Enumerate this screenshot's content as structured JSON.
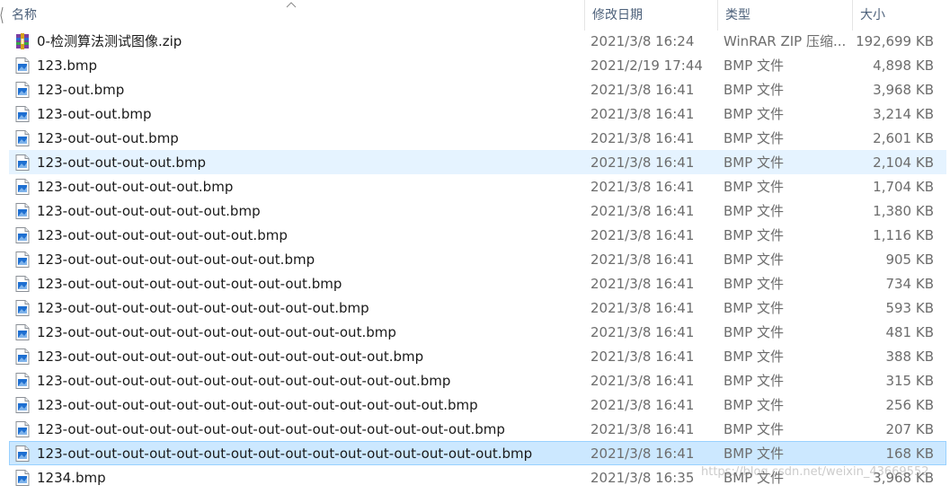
{
  "columns": {
    "name": "名称",
    "date": "修改日期",
    "type": "类型",
    "size": "大小"
  },
  "files": [
    {
      "name": "0-检测算法测试图像.zip",
      "date": "2021/3/8 16:24",
      "type": "WinRAR ZIP 压缩...",
      "size": "192,699 KB",
      "icon": "winrar-archive-icon"
    },
    {
      "name": "123.bmp",
      "date": "2021/2/19 17:44",
      "type": "BMP 文件",
      "size": "4,898 KB",
      "icon": "bmp-file-icon"
    },
    {
      "name": "123-out.bmp",
      "date": "2021/3/8 16:41",
      "type": "BMP 文件",
      "size": "3,968 KB",
      "icon": "bmp-file-icon"
    },
    {
      "name": "123-out-out.bmp",
      "date": "2021/3/8 16:41",
      "type": "BMP 文件",
      "size": "3,214 KB",
      "icon": "bmp-file-icon"
    },
    {
      "name": "123-out-out-out.bmp",
      "date": "2021/3/8 16:41",
      "type": "BMP 文件",
      "size": "2,601 KB",
      "icon": "bmp-file-icon"
    },
    {
      "name": "123-out-out-out-out.bmp",
      "date": "2021/3/8 16:41",
      "type": "BMP 文件",
      "size": "2,104 KB",
      "icon": "bmp-file-icon",
      "state": "hover"
    },
    {
      "name": "123-out-out-out-out-out.bmp",
      "date": "2021/3/8 16:41",
      "type": "BMP 文件",
      "size": "1,704 KB",
      "icon": "bmp-file-icon"
    },
    {
      "name": "123-out-out-out-out-out-out.bmp",
      "date": "2021/3/8 16:41",
      "type": "BMP 文件",
      "size": "1,380 KB",
      "icon": "bmp-file-icon"
    },
    {
      "name": "123-out-out-out-out-out-out-out.bmp",
      "date": "2021/3/8 16:41",
      "type": "BMP 文件",
      "size": "1,116 KB",
      "icon": "bmp-file-icon"
    },
    {
      "name": "123-out-out-out-out-out-out-out-out.bmp",
      "date": "2021/3/8 16:41",
      "type": "BMP 文件",
      "size": "905 KB",
      "icon": "bmp-file-icon"
    },
    {
      "name": "123-out-out-out-out-out-out-out-out-out.bmp",
      "date": "2021/3/8 16:41",
      "type": "BMP 文件",
      "size": "734 KB",
      "icon": "bmp-file-icon"
    },
    {
      "name": "123-out-out-out-out-out-out-out-out-out-out.bmp",
      "date": "2021/3/8 16:41",
      "type": "BMP 文件",
      "size": "593 KB",
      "icon": "bmp-file-icon"
    },
    {
      "name": "123-out-out-out-out-out-out-out-out-out-out-out.bmp",
      "date": "2021/3/8 16:41",
      "type": "BMP 文件",
      "size": "481 KB",
      "icon": "bmp-file-icon"
    },
    {
      "name": "123-out-out-out-out-out-out-out-out-out-out-out-out.bmp",
      "date": "2021/3/8 16:41",
      "type": "BMP 文件",
      "size": "388 KB",
      "icon": "bmp-file-icon"
    },
    {
      "name": "123-out-out-out-out-out-out-out-out-out-out-out-out-out.bmp",
      "date": "2021/3/8 16:41",
      "type": "BMP 文件",
      "size": "315 KB",
      "icon": "bmp-file-icon"
    },
    {
      "name": "123-out-out-out-out-out-out-out-out-out-out-out-out-out-out.bmp",
      "date": "2021/3/8 16:41",
      "type": "BMP 文件",
      "size": "256 KB",
      "icon": "bmp-file-icon"
    },
    {
      "name": "123-out-out-out-out-out-out-out-out-out-out-out-out-out-out-out.bmp",
      "date": "2021/3/8 16:41",
      "type": "BMP 文件",
      "size": "207 KB",
      "icon": "bmp-file-icon"
    },
    {
      "name": "123-out-out-out-out-out-out-out-out-out-out-out-out-out-out-out-out.bmp",
      "date": "2021/3/8 16:41",
      "type": "BMP 文件",
      "size": "168 KB",
      "icon": "bmp-file-icon",
      "state": "selected"
    },
    {
      "name": "1234.bmp",
      "date": "2021/3/8 16:35",
      "type": "BMP 文件",
      "size": "3,968 KB",
      "icon": "bmp-file-icon"
    }
  ],
  "watermark": "https://blog.csdn.net/weixin_43669552",
  "colors": {
    "hover": "#e5f3ff",
    "selected": "#cce8ff",
    "selected_border": "#99d1ff",
    "header_text": "#4c607a"
  }
}
